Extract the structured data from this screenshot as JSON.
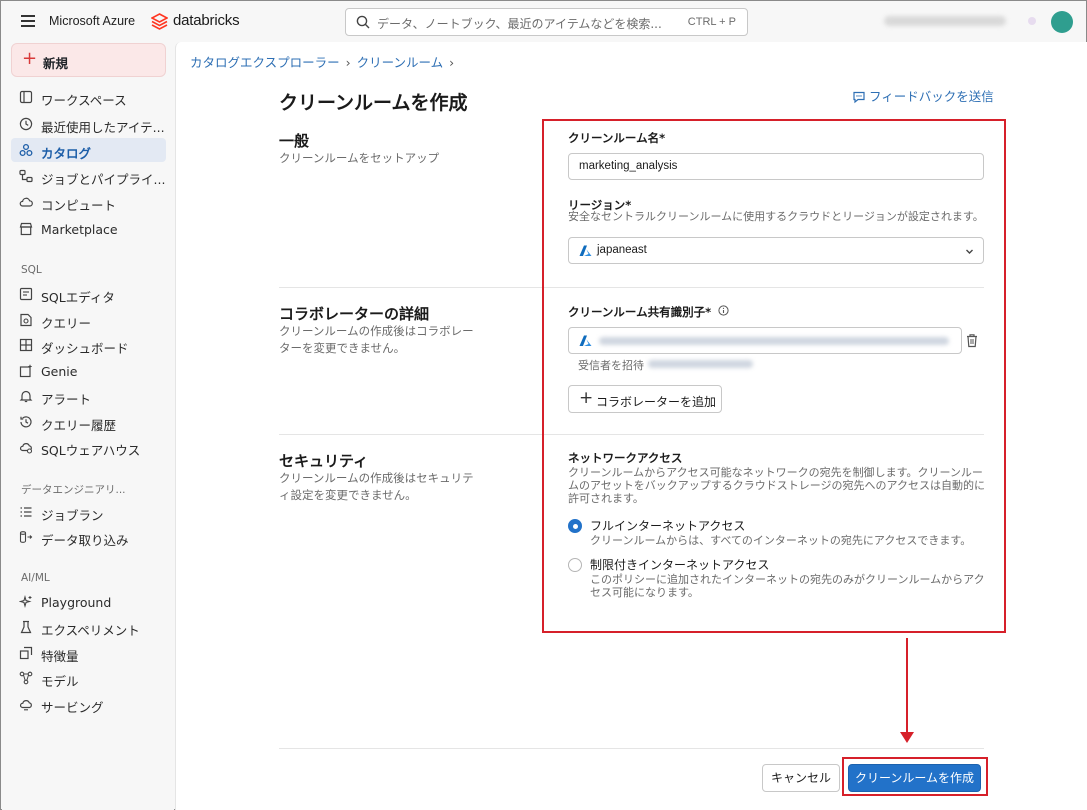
{
  "topbar": {
    "brand": "Microsoft Azure",
    "product": "databricks",
    "search_placeholder": "データ、ノートブック、最近のアイテムなどを検索...",
    "search_shortcut": "CTRL + P"
  },
  "sidebar": {
    "new_label": "新規",
    "items": [
      {
        "label": "ワークスペース",
        "icon": "workspace-icon"
      },
      {
        "label": "最近使用したアイテ...",
        "icon": "clock-icon"
      },
      {
        "label": "カタログ",
        "icon": "catalog-icon",
        "active": true
      },
      {
        "label": "ジョブとパイプライ...",
        "icon": "workflow-icon"
      },
      {
        "label": "コンピュート",
        "icon": "cloud-icon"
      },
      {
        "label": "Marketplace",
        "icon": "store-icon"
      }
    ],
    "sections": [
      {
        "title": "SQL",
        "items": [
          {
            "label": "SQLエディタ",
            "icon": "sql-editor-icon"
          },
          {
            "label": "クエリー",
            "icon": "query-icon"
          },
          {
            "label": "ダッシュボード",
            "icon": "dashboard-icon"
          },
          {
            "label": "Genie",
            "icon": "genie-icon"
          },
          {
            "label": "アラート",
            "icon": "bell-icon"
          },
          {
            "label": "クエリー履歴",
            "icon": "history-icon"
          },
          {
            "label": "SQLウェアハウス",
            "icon": "warehouse-icon"
          }
        ]
      },
      {
        "title": "データエンジニアリ...",
        "items": [
          {
            "label": "ジョブラン",
            "icon": "job-runs-icon"
          },
          {
            "label": "データ取り込み",
            "icon": "ingest-icon"
          }
        ]
      },
      {
        "title": "AI/ML",
        "items": [
          {
            "label": "Playground",
            "icon": "sparkle-icon"
          },
          {
            "label": "エクスペリメント",
            "icon": "flask-icon"
          },
          {
            "label": "特徴量",
            "icon": "features-icon"
          },
          {
            "label": "モデル",
            "icon": "models-icon"
          },
          {
            "label": "サービング",
            "icon": "serving-icon"
          }
        ]
      }
    ]
  },
  "breadcrumb": [
    "カタログエクスプローラー",
    "クリーンルーム"
  ],
  "breadcrumb_sep": "›",
  "page": {
    "title": "クリーンルームを作成",
    "feedback": "フィードバックを送信"
  },
  "general": {
    "title": "一般",
    "desc": "クリーンルームをセットアップ",
    "name_label": "クリーンルーム名*",
    "name_value": "marketing_analysis",
    "region_label": "リージョン*",
    "region_help": "安全なセントラルクリーンルームに使用するクラウドとリージョンが設定されます。",
    "region_value": "japaneast"
  },
  "collaborator": {
    "title": "コラボレーターの詳細",
    "desc": "クリーンルームの作成後はコラボレーターを変更できません。",
    "sharing_id_label": "クリーンルーム共有識別子*",
    "invite_label": "受信者を招待",
    "add_label": "コラボレーターを追加"
  },
  "security": {
    "title": "セキュリティ",
    "desc": "クリーンルームの作成後はセキュリティ設定を変更できません。",
    "network_label": "ネットワークアクセス",
    "network_help": "クリーンルームからアクセス可能なネットワークの宛先を制御します。クリーンルームのアセットをバックアップするクラウドストレージの宛先へのアクセスは自動的に許可されます。",
    "options": [
      {
        "label": "フルインターネットアクセス",
        "desc": "クリーンルームからは、すべてのインターネットの宛先にアクセスできます。",
        "selected": true
      },
      {
        "label": "制限付きインターネットアクセス",
        "desc": "このポリシーに追加されたインターネットの宛先のみがクリーンルームからアクセス可能になります。",
        "selected": false
      }
    ]
  },
  "footer": {
    "cancel": "キャンセル",
    "create": "クリーンルームを作成"
  },
  "colors": {
    "accent": "#2272c9",
    "highlight": "#d6202a",
    "link": "#2e6fb4"
  }
}
